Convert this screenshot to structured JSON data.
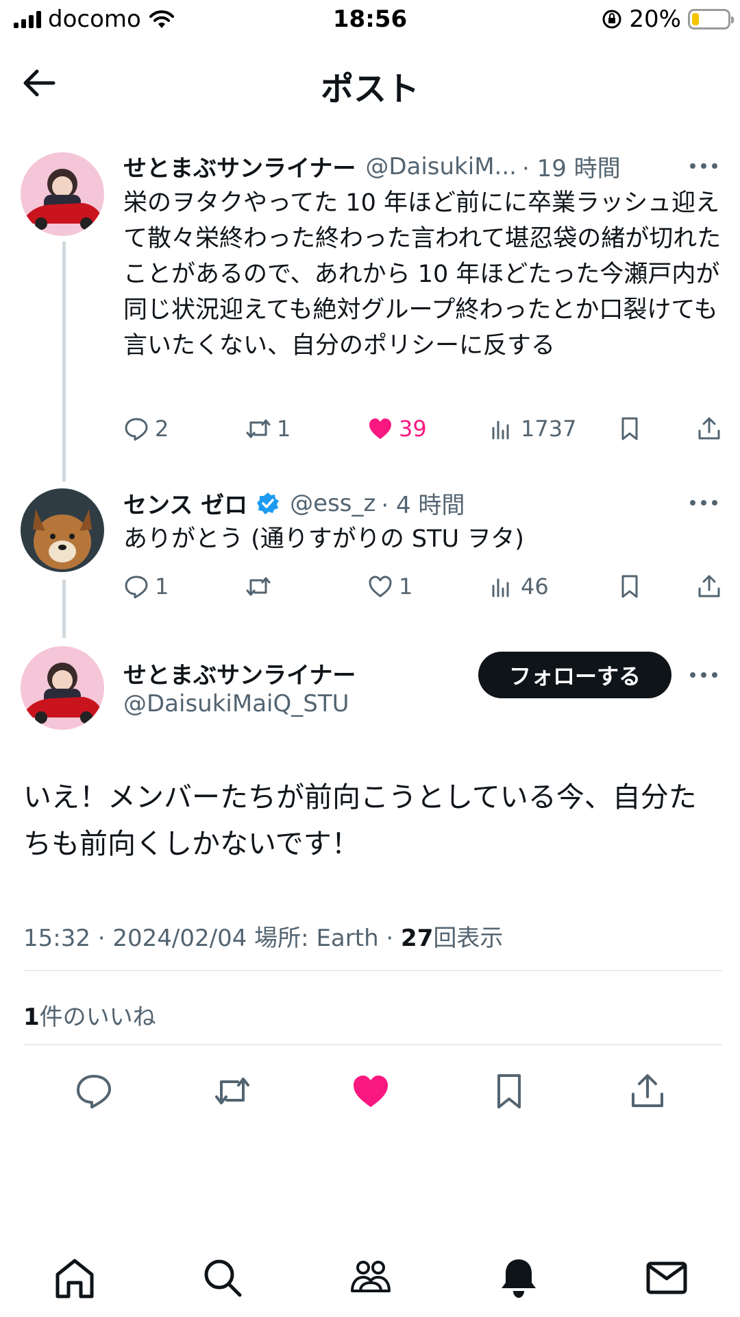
{
  "status_bar": {
    "carrier": "docomo",
    "time": "18:56",
    "battery_percent": "20%",
    "battery_level": 0.2
  },
  "header": {
    "title": "ポスト"
  },
  "tweet1": {
    "name": "せとまぶサンライナー",
    "handle": "@DaisukiM...",
    "time": "· 19 時間",
    "text": "栄のヲタクやってた 10 年ほど前にに卒業ラッシュ迎えて散々栄終わった終わった言われて堪忍袋の緒が切れたことがあるので、あれから 10 年ほどたった今瀬戸内が同じ状況迎えても絶対グループ終わったとか口裂けても言いたくない、自分のポリシーに反する",
    "replies": "2",
    "retweets": "1",
    "likes": "39",
    "views": "1737"
  },
  "tweet2": {
    "name": "センス ゼロ",
    "handle": "@ess_z",
    "time": "· 4 時間",
    "text": "ありがとう (通りすがりの STU ヲタ)",
    "replies": "1",
    "retweets": "",
    "likes": "1",
    "views": "46"
  },
  "main_post": {
    "name": "せとまぶサンライナー",
    "handle": "@DaisukiMaiQ_STU",
    "follow_label": "フォローする",
    "text": "いえ！メンバーたちが前向こうとしている今、自分たちも前向くしかないです！",
    "time_place": "15:32 · 2024/02/04 場所: Earth · ",
    "view_count": "27",
    "view_suffix": "回表示",
    "likes_count": "1",
    "likes_label": "件のいいね"
  },
  "colors": {
    "like_pink": "#f91880",
    "verified_blue": "#1d9bf0",
    "text_primary": "#0f1419",
    "text_secondary": "#536471"
  },
  "icons": {
    "back": "arrow-left-icon",
    "more": "more-dots-icon",
    "reply": "reply-bubble-icon",
    "retweet": "retweet-icon",
    "like": "heart-icon",
    "views": "bar-chart-icon",
    "bookmark": "bookmark-icon",
    "share": "share-upload-icon",
    "tabs": [
      "home-icon",
      "search-icon",
      "communities-icon",
      "notifications-bell-icon",
      "messages-envelope-icon"
    ]
  }
}
